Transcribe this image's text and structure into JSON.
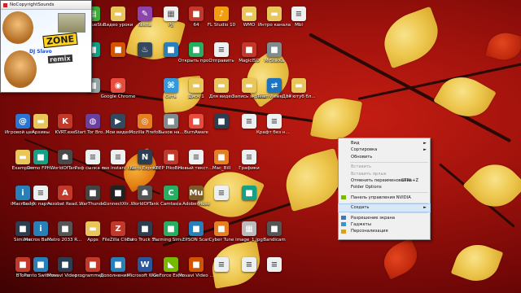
{
  "thumbnail_window": {
    "title": "NoCopyrightSounds",
    "zone_text": "ZONE",
    "dj_text": "DJ Slavo",
    "remix_text": "remix"
  },
  "desktop_icons": [
    {
      "label": "Start BlueStacks",
      "icon": "bluestacks-icon",
      "color": "#3fae3b"
    },
    {
      "label": "Видео уроки",
      "icon": "folder-icon",
      "color": "#e8c65a"
    },
    {
      "label": "Nikita",
      "icon": "paint-icon",
      "color": "#8e44ad"
    },
    {
      "label": "Pjj",
      "icon": "image-icon",
      "color": "#f0f0f0"
    },
    {
      "label": "64",
      "icon": "app-icon",
      "color": "#c0392b"
    },
    {
      "label": "FL Studio 10",
      "icon": "flstudio-icon",
      "color": "#f39c12"
    },
    {
      "label": "WMO",
      "icon": "folder-icon",
      "color": "#e8c65a"
    },
    {
      "label": "Интро канала",
      "icon": "folder-icon",
      "color": "#e8c65a"
    },
    {
      "label": "Mbl",
      "icon": "document-icon",
      "color": "#f0f0f0"
    },
    {
      "label": "",
      "icon": "app-icon",
      "color": "#16a085"
    },
    {
      "label": "",
      "icon": "app-icon",
      "color": "#d35400"
    },
    {
      "label": "",
      "icon": "steam-icon",
      "color": "#34495e"
    },
    {
      "label": "",
      "icon": "app-icon",
      "color": "#2980b9"
    },
    {
      "label": "Открыть проект",
      "icon": "app-icon",
      "color": "#27ae60"
    },
    {
      "label": "Отправить",
      "icon": "document-icon",
      "color": "#ecf0f1"
    },
    {
      "label": "MagicISO",
      "icon": "app-icon",
      "color": "#c0392b"
    },
    {
      "label": "MrStikKa",
      "icon": "app-icon",
      "color": "#7f8c8d"
    },
    {
      "label": "",
      "icon": "app-icon",
      "color": "#95a5a6"
    },
    {
      "label": "Google Chrome",
      "icon": "chrome-icon",
      "color": "#e74c3c"
    },
    {
      "label": "Сеть",
      "icon": "network-icon",
      "color": "#3498db"
    },
    {
      "label": "Диск 1",
      "icon": "folder-icon",
      "color": "#e8c65a"
    },
    {
      "label": "Для видео",
      "icon": "folder-icon",
      "color": "#e8c65a"
    },
    {
      "label": "Запись экрана",
      "icon": "folder-icon",
      "color": "#e8c65a"
    },
    {
      "label": "TeamViewer 10",
      "icon": "teamviewer-icon",
      "color": "#1e73be"
    },
    {
      "label": "Для ютуб бл...",
      "icon": "folder-icon",
      "color": "#e8c65a"
    },
    {
      "label": "Игровой центр@Mail.Ru",
      "icon": "mail-icon",
      "color": "#2c74d4"
    },
    {
      "label": "Архивы",
      "icon": "folder-icon",
      "color": "#e8c65a"
    },
    {
      "label": "KVRT.exe",
      "icon": "kaspersky-icon",
      "color": "#c0392b"
    },
    {
      "label": "Start Tor Browser",
      "icon": "tor-icon",
      "color": "#6b3fa0"
    },
    {
      "label": "Мои видео",
      "icon": "video-icon",
      "color": "#34495e"
    },
    {
      "label": "Mozilla Firefox",
      "icon": "firefox-icon",
      "color": "#e67e22"
    },
    {
      "label": "Вызов на...",
      "icon": "app-icon",
      "color": "#7f8c8d"
    },
    {
      "label": "BurnAware",
      "icon": "app-icon",
      "color": "#e74c3c"
    },
    {
      "label": "",
      "icon": "app-icon",
      "color": "#2c3e50"
    },
    {
      "label": "",
      "icon": "document-icon",
      "color": "#ecf0f1"
    },
    {
      "label": "Крафт без названия",
      "icon": "document-icon",
      "color": "#ecf0f1"
    },
    {
      "label": "Examples",
      "icon": "folder-icon",
      "color": "#e8c65a"
    },
    {
      "label": "Demo FPH...",
      "icon": "app-icon",
      "color": "#16a085"
    },
    {
      "label": "WorldOfTan...",
      "icon": "wot-icon",
      "color": "#4a4a4a"
    },
    {
      "label": "Реф сылка партнерки",
      "icon": "document-icon",
      "color": "#ecf0f1"
    },
    {
      "label": "reo instant txt",
      "icon": "document-icon",
      "color": "#ecf0f1"
    },
    {
      "label": "Nero Express",
      "icon": "nero-icon",
      "color": "#2c3e50"
    },
    {
      "label": "KEEP PikoBrush...",
      "icon": "app-icon",
      "color": "#c0392b"
    },
    {
      "label": "Новый текстовый...",
      "icon": "document-icon",
      "color": "#ecf0f1"
    },
    {
      "label": "Mac_Bill",
      "icon": "app-icon",
      "color": "#e67e22"
    },
    {
      "label": "Графики",
      "icon": "document-icon",
      "color": "#ecf0f1"
    },
    {
      "label": "iMacros 10",
      "icon": "imacros-icon",
      "color": "#2980b9"
    },
    {
      "label": "Бонус партнеров...",
      "icon": "document-icon",
      "color": "#ecf0f1"
    },
    {
      "label": "Acrobat Reader DC",
      "icon": "acrobat-icon",
      "color": "#c0392b"
    },
    {
      "label": "WarThunder",
      "icon": "app-icon",
      "color": "#444"
    },
    {
      "label": "ConnectXtr...",
      "icon": "app-icon",
      "color": "#222"
    },
    {
      "label": "WorldOfTank",
      "icon": "wot-icon",
      "color": "#555"
    },
    {
      "label": "Camtasia",
      "icon": "camtasia-icon",
      "color": "#27ae60"
    },
    {
      "label": "Adobe Muse",
      "icon": "muse-icon",
      "color": "#7d5a2a"
    },
    {
      "label": "",
      "icon": "document-icon",
      "color": "#ecf0f1"
    },
    {
      "label": "",
      "icon": "app-icon",
      "color": "#16a085"
    },
    {
      "label": "Sim.exe",
      "icon": "app-icon",
      "color": "#2c3e50"
    },
    {
      "label": "iMacros Batch Sample",
      "icon": "imacros-icon",
      "color": "#2980b9"
    },
    {
      "label": "Metro 2033 Redux",
      "icon": "app-icon",
      "color": "#555"
    },
    {
      "label": "Apps",
      "icon": "folder-icon",
      "color": "#e8c65a"
    },
    {
      "label": "FileZilla Client",
      "icon": "filezilla-icon",
      "color": "#c0392b"
    },
    {
      "label": "Euro Truck Simulator 2",
      "icon": "app-icon",
      "color": "#2c3e50"
    },
    {
      "label": "Farming Simulator 15",
      "icon": "app-icon",
      "color": "#27ae60"
    },
    {
      "label": "EPSON Scan",
      "icon": "app-icon",
      "color": "#2980b9"
    },
    {
      "label": "Cyber Tune",
      "icon": "app-icon",
      "color": "#e67e22"
    },
    {
      "label": "image_1.jpg",
      "icon": "image-icon",
      "color": "#bbb"
    },
    {
      "label": "Bandicam",
      "icon": "app-icon",
      "color": "#555"
    },
    {
      "label": "BTone",
      "icon": "app-icon",
      "color": "#c0392b"
    },
    {
      "label": "Punto Switcher",
      "icon": "app-icon",
      "color": "#2980b9"
    },
    {
      "label": "Movavi Video Converter 15",
      "icon": "app-icon",
      "color": "#2c3e50"
    },
    {
      "label": "programmer Paranoid",
      "icon": "app-icon",
      "color": "#c0392b"
    },
    {
      "label": "Дополнения Дивиденды",
      "icon": "app-icon",
      "color": "#2980b9"
    },
    {
      "label": "Microsoft Word 2010",
      "icon": "word-icon",
      "color": "#2b579a"
    },
    {
      "label": "GeForce Experience",
      "icon": "nvidia-icon",
      "color": "#76b900"
    },
    {
      "label": "Movavi Video Editor",
      "icon": "app-icon",
      "color": "#d35400"
    },
    {
      "label": "",
      "icon": "document-icon",
      "color": "#ecf0f1"
    },
    {
      "label": "",
      "icon": "document-icon",
      "color": "#ecf0f1"
    },
    {
      "label": "",
      "icon": "document-icon",
      "color": "#ecf0f1"
    },
    {
      "label": "",
      "icon": "app-icon",
      "color": "#1e3a5f"
    }
  ],
  "context_menu": {
    "items": [
      {
        "type": "item",
        "label": "Вид",
        "arrow": "►",
        "disabled": false
      },
      {
        "type": "item",
        "label": "Сортировка",
        "arrow": "►",
        "disabled": false
      },
      {
        "type": "item",
        "label": "Обновить",
        "disabled": false
      },
      {
        "type": "separator"
      },
      {
        "type": "item",
        "label": "Вставить",
        "disabled": true
      },
      {
        "type": "item",
        "label": "Вставить ярлык",
        "disabled": true
      },
      {
        "type": "item",
        "label": "Отменить переименование",
        "shortcut": "CTRL+Z",
        "disabled": false
      },
      {
        "type": "item",
        "label": "Folder Options",
        "disabled": false
      },
      {
        "type": "separator"
      },
      {
        "type": "item",
        "label": "Панель управления NVIDIA",
        "icon": "nvidia-icon",
        "disabled": false
      },
      {
        "type": "separator"
      },
      {
        "type": "item",
        "label": "Создать",
        "arrow": "►",
        "disabled": false,
        "highlight": true
      },
      {
        "type": "separator"
      },
      {
        "type": "item",
        "label": "Разрешение экрана",
        "icon": "screen-resolution-icon",
        "disabled": false
      },
      {
        "type": "item",
        "label": "Гаджеты",
        "icon": "gadgets-icon",
        "disabled": false
      },
      {
        "type": "item",
        "label": "Персонализация",
        "icon": "personalize-icon",
        "disabled": false
      }
    ]
  }
}
